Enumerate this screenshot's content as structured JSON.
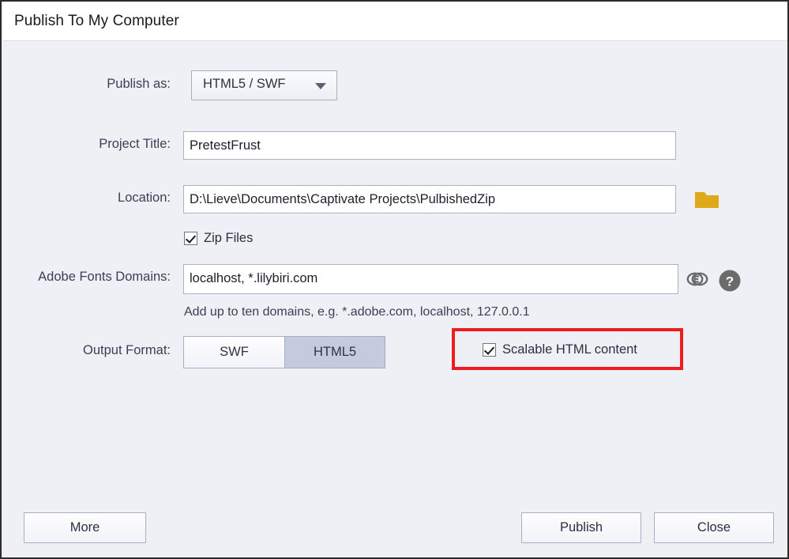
{
  "window": {
    "title": "Publish To My Computer"
  },
  "form": {
    "publish_as": {
      "label": "Publish as:",
      "value": "HTML5 / SWF",
      "arrow_icon": "chevron-down-icon"
    },
    "project_title": {
      "label": "Project Title:",
      "value": "PretestFrust",
      "placeholder": ""
    },
    "location": {
      "label": "Location:",
      "value": "D:\\Lieve\\Documents\\Captivate Projects\\PulbishedZip",
      "placeholder": "",
      "browse_icon": "folder-icon"
    },
    "zip_files": {
      "label": "Zip Files",
      "checked": true
    },
    "adobe_fonts_domains": {
      "label": "Adobe Fonts Domains:",
      "value": "localhost, *.lilybiri.com",
      "placeholder": "",
      "hint": "Add up to ten domains, e.g. *.adobe.com, localhost, 127.0.0.1",
      "link_icon": "creative-cloud-link-icon",
      "help_icon": "help-circle-icon"
    },
    "output_format": {
      "label": "Output Format:",
      "options": [
        {
          "label": "SWF",
          "selected": false
        },
        {
          "label": "HTML5",
          "selected": true
        }
      ]
    },
    "scalable_html_content": {
      "label": "Scalable HTML content",
      "checked": true,
      "highlight_color": "#ee1c1c"
    }
  },
  "footer": {
    "more_label": "More",
    "publish_label": "Publish",
    "close_label": "Close"
  },
  "colors": {
    "dialog_background": "#eef0f5",
    "titlebar_background": "#ffffff",
    "input_background": "#ffffff",
    "input_border": "#a9b1c6",
    "label_text": "#3a3f52",
    "selected_segment": "#c5cade",
    "folder_icon": "#e0a919",
    "annotation_red": "#ee1c1c",
    "icon_gray": "#6b6b6b"
  }
}
